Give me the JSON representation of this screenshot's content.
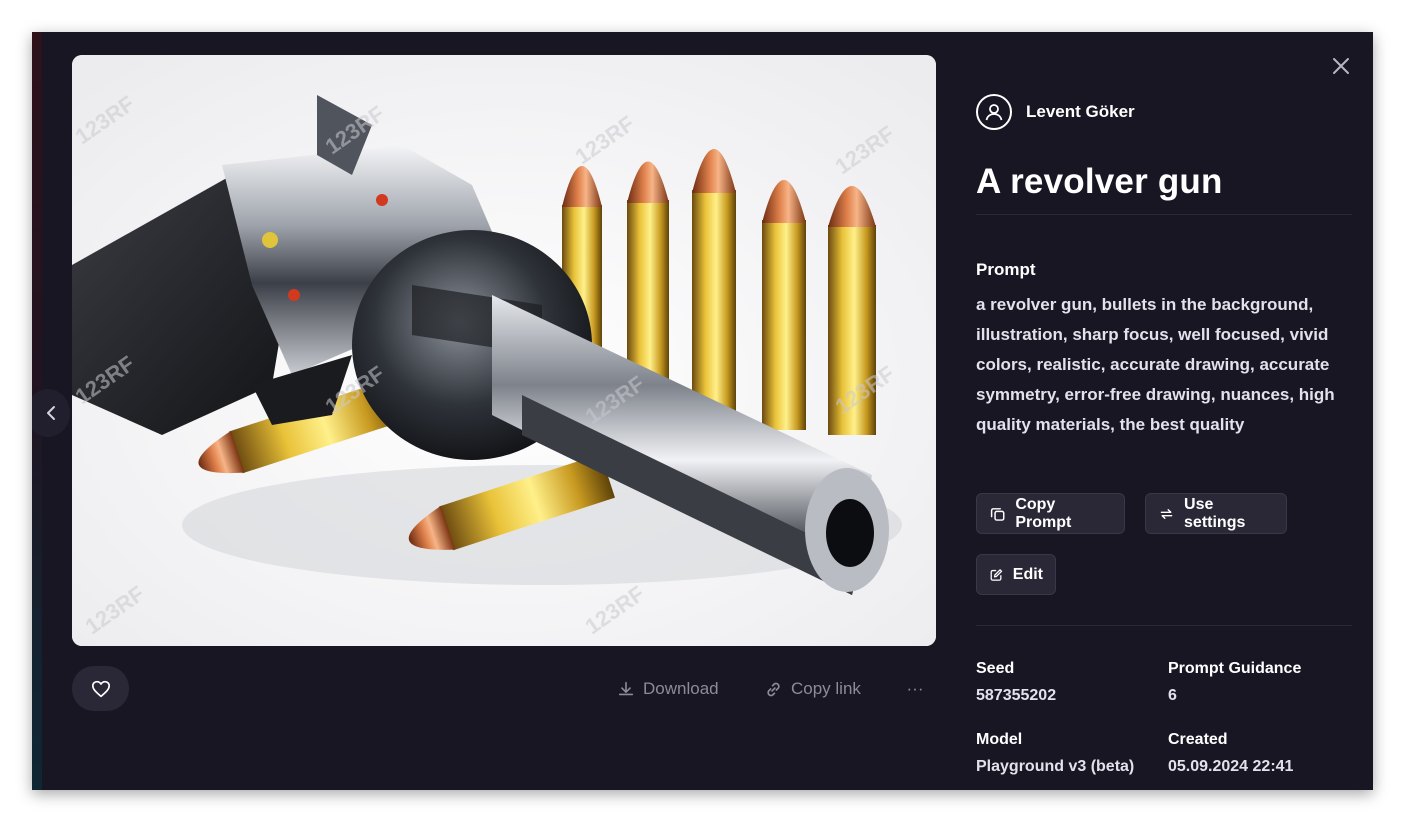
{
  "modal": {
    "author": {
      "name": "Levent Göker"
    },
    "title": "A revolver gun",
    "prompt_label": "Prompt",
    "prompt_text": "a revolver gun, bullets in the background, illustration, sharp focus, well focused, vivid colors, realistic, accurate drawing, accurate symmetry, error-free drawing, nuances, high quality materials, the best quality",
    "buttons": {
      "copy_prompt": "Copy Prompt",
      "use_settings": "Use settings",
      "edit": "Edit"
    },
    "image_actions": {
      "download": "Download",
      "copy_link": "Copy link",
      "more": "···"
    },
    "meta": {
      "seed_label": "Seed",
      "seed_value": "587355202",
      "guidance_label": "Prompt Guidance",
      "guidance_value": "6",
      "model_label": "Model",
      "model_value": "Playground v3 (beta)",
      "created_label": "Created",
      "created_value": "05.09.2024 22:41"
    },
    "watermark": "123RF"
  },
  "colors": {
    "panel_bg": "#181623",
    "button_bg": "#2a2736",
    "muted_text": "#8d8a99"
  }
}
